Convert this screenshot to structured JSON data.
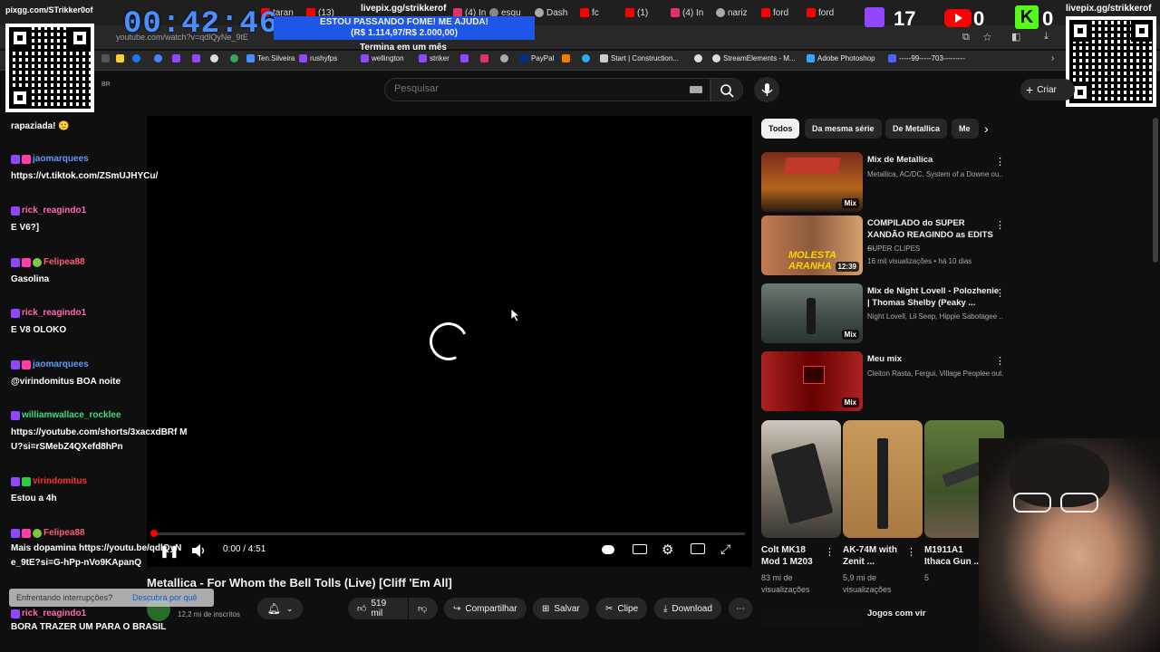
{
  "browser": {
    "url": "youtube.com/watch?v=qdlQyNe_9tE",
    "tabs": [
      "(4) In",
      "taran",
      "(13)",
      "(4) In",
      "esqu",
      "Dash",
      "fc",
      "(1)",
      "(4) In",
      "nariz",
      "ford",
      "ford"
    ],
    "bookmarks": [
      "Ten.Silveira",
      "rushyfps",
      "wellington",
      "striker",
      "PayPal",
      "Start | Construction...",
      "StreamElements - M...",
      "Adobe Photoshop",
      "-----99-----703---------"
    ]
  },
  "overlay": {
    "timer": "00:42:46",
    "livepix_top": "livepix.gg/strikkerof",
    "banner_line1": "ESTOU PASSANDO FOME! ME AJUDA!",
    "banner_line2": "(R$ 1.114,97/R$ 2.000,00)",
    "banner_sub": "Termina em um mês",
    "qr_left_label": "pixgg.com/STrikker0of",
    "qr_right_label": "livepix.gg/strikkerof",
    "twitch_count": "17",
    "youtube_count": "0",
    "kick_count": "0",
    "brand_accent": "#4a8fff",
    "banner_color": "#1e56e8"
  },
  "header": {
    "search_placeholder": "Pesquisar",
    "create_label": "Criar",
    "region": "BR"
  },
  "chat": {
    "messages": [
      {
        "user": "",
        "text": "rapaziada! 🙂",
        "color": "#ffffff"
      },
      {
        "user": "jaomarquees",
        "text": "https://vt.tiktok.com/ZSmUJHYCu/",
        "color": "#5f9bff"
      },
      {
        "user": "rick_reagindo1",
        "text": "E V6?]",
        "color": "#ff69b4"
      },
      {
        "user": "Felipea88",
        "text": "Gasolina",
        "color": "#ff5a7a"
      },
      {
        "user": "rick_reagindo1",
        "text": "E V8 OLOKO",
        "color": "#ff69b4"
      },
      {
        "user": "jaomarquees",
        "text": "@virindomitus BOA noite",
        "color": "#5f9bff"
      },
      {
        "user": "williamwallace_rocklee",
        "text": "https://youtube.com/shorts/3xacxdBRf MU?si=rSMebZ4QXefd8hPn",
        "color": "#3ddc84"
      },
      {
        "user": "virindomitus",
        "text": "Estou a 4h",
        "color": "#ff2e2e"
      },
      {
        "user": "Felipea88",
        "text": "Mais dopamina https://youtu.be/qdlQyNe_9tE?si=G-hPp-nVo9KApanQ",
        "color": "#ff5a7a"
      },
      {
        "user": "rick_reagindo1",
        "text": "BORA TRAZER UM PARA O BRASIL",
        "color": "#ff69b4"
      }
    ]
  },
  "player": {
    "time": "0:00 / 4:51",
    "progress": 0.0,
    "title": "Metallica - For Whom the Bell Tolls (Live) [Cliff 'Em All]",
    "subscribers": "12,2 mi de inscritos",
    "popup_text": "Enfrentando interrupções?",
    "popup_link": "Descubra por quê"
  },
  "actions": {
    "likes": "519 mil",
    "share": "Compartilhar",
    "save": "Salvar",
    "clip": "Clipe",
    "download": "Download"
  },
  "sidebar": {
    "chips": [
      "Todos",
      "Da mesma série",
      "De Metallica",
      "Me"
    ],
    "recommendations": [
      {
        "title": "Mix de Metallica",
        "meta1": "Metallica, AC/DC, System of a Downe ou...",
        "meta2": "",
        "badge": "Mix"
      },
      {
        "title": "COMPILADO do SUPER XANDÃO REAGINDO as EDITS ...",
        "meta1": "SUPER CLIPES",
        "meta2": "16 mil visualizações • há 10 dias",
        "badge": "12:39",
        "thumb_text": "MOLESTA ARANHA"
      },
      {
        "title": "Mix de Night Lovell - Polozhenie | Thomas Shelby (Peaky ...",
        "meta1": "Night Lovell, Lil Seep, Hippie Sabotagee ...",
        "meta2": "",
        "badge": "Mix"
      },
      {
        "title": "Meu mix",
        "meta1": "Cleiton Rasta, Fergui, Village Peoplee out...",
        "meta2": "",
        "badge": "Mix"
      }
    ],
    "shorts": [
      {
        "title": "Colt MK18 Mod 1 M203",
        "views": "83 mi de visualizações"
      },
      {
        "title": "AK-74M with Zenit ...",
        "views": "5,9 mi de visualizações"
      },
      {
        "title": "M1911A1 Ithaca Gun ...",
        "views": "5"
      }
    ],
    "footer_label": "Jogos com vir"
  }
}
